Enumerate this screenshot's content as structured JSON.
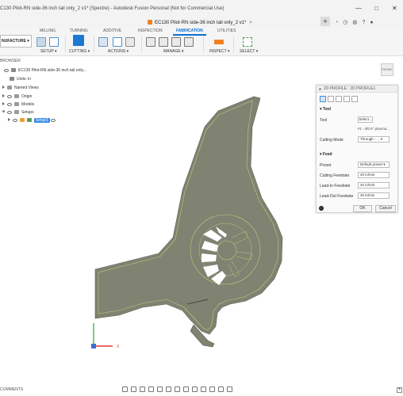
{
  "titlebar": {
    "title": "C130 Pilot-RN side-36 inch tail only_2 v1* (Spectre) - Autodesk Fusion Personal (Not for Commercial Use)",
    "minimize": "—",
    "maximize": "□",
    "close": "✕"
  },
  "doc_tab": {
    "label": "EC130 Pilot-RN side-36 inch tail only_2 v1*",
    "close": "×"
  },
  "tab_plus": "+",
  "ribbon": {
    "workspace": "NUFACTURE",
    "tabs": [
      "MILLING",
      "TURNING",
      "ADDITIVE",
      "INSPECTION",
      "FABRICATION",
      "UTILITIES"
    ],
    "active_tab": "FABRICATION",
    "groups": [
      "SETUP",
      "CUTTING",
      "ACTIONS",
      "MANAGE",
      "INSPECT",
      "SELECT"
    ]
  },
  "browser": {
    "header": "BROWSER",
    "items": [
      {
        "label": "EC130 Pilot-RN side-36 inch tail only..."
      },
      {
        "label": "Units: in"
      },
      {
        "label": "Named Views"
      },
      {
        "label": "Origin"
      },
      {
        "label": "Models"
      },
      {
        "label": "Setups"
      },
      {
        "label": "Setup1"
      }
    ]
  },
  "viewcube": "FRONT",
  "dialog": {
    "title": "2D PROFILE : 2D PROFILE1",
    "tool_section": "Tool",
    "tool_label": "Tool",
    "tool_button": "Select...",
    "tool_desc": "#1 - Ø0.5\" plasma...",
    "cutting_mode_label": "Cutting Mode",
    "cutting_mode_value": "Through - ...",
    "feed_section": "Feed",
    "preset_label": "Preset",
    "preset_value": "Default preset",
    "cutting_feedrate_label": "Cutting Feedrate",
    "cutting_feedrate_value": "40 in/min",
    "leadin_label": "Lead-In Feedrate",
    "leadin_value": "40 in/min",
    "leadout_label": "Lead-Out Feedrate",
    "leadout_value": "40 in/min",
    "ok": "OK",
    "cancel": "Cancel"
  },
  "axis_x": "X",
  "comments": "COMMENTS",
  "colors": {
    "accent": "#0b6fd1",
    "model_fill": "#808272",
    "toolpath": "#c8c77a"
  }
}
